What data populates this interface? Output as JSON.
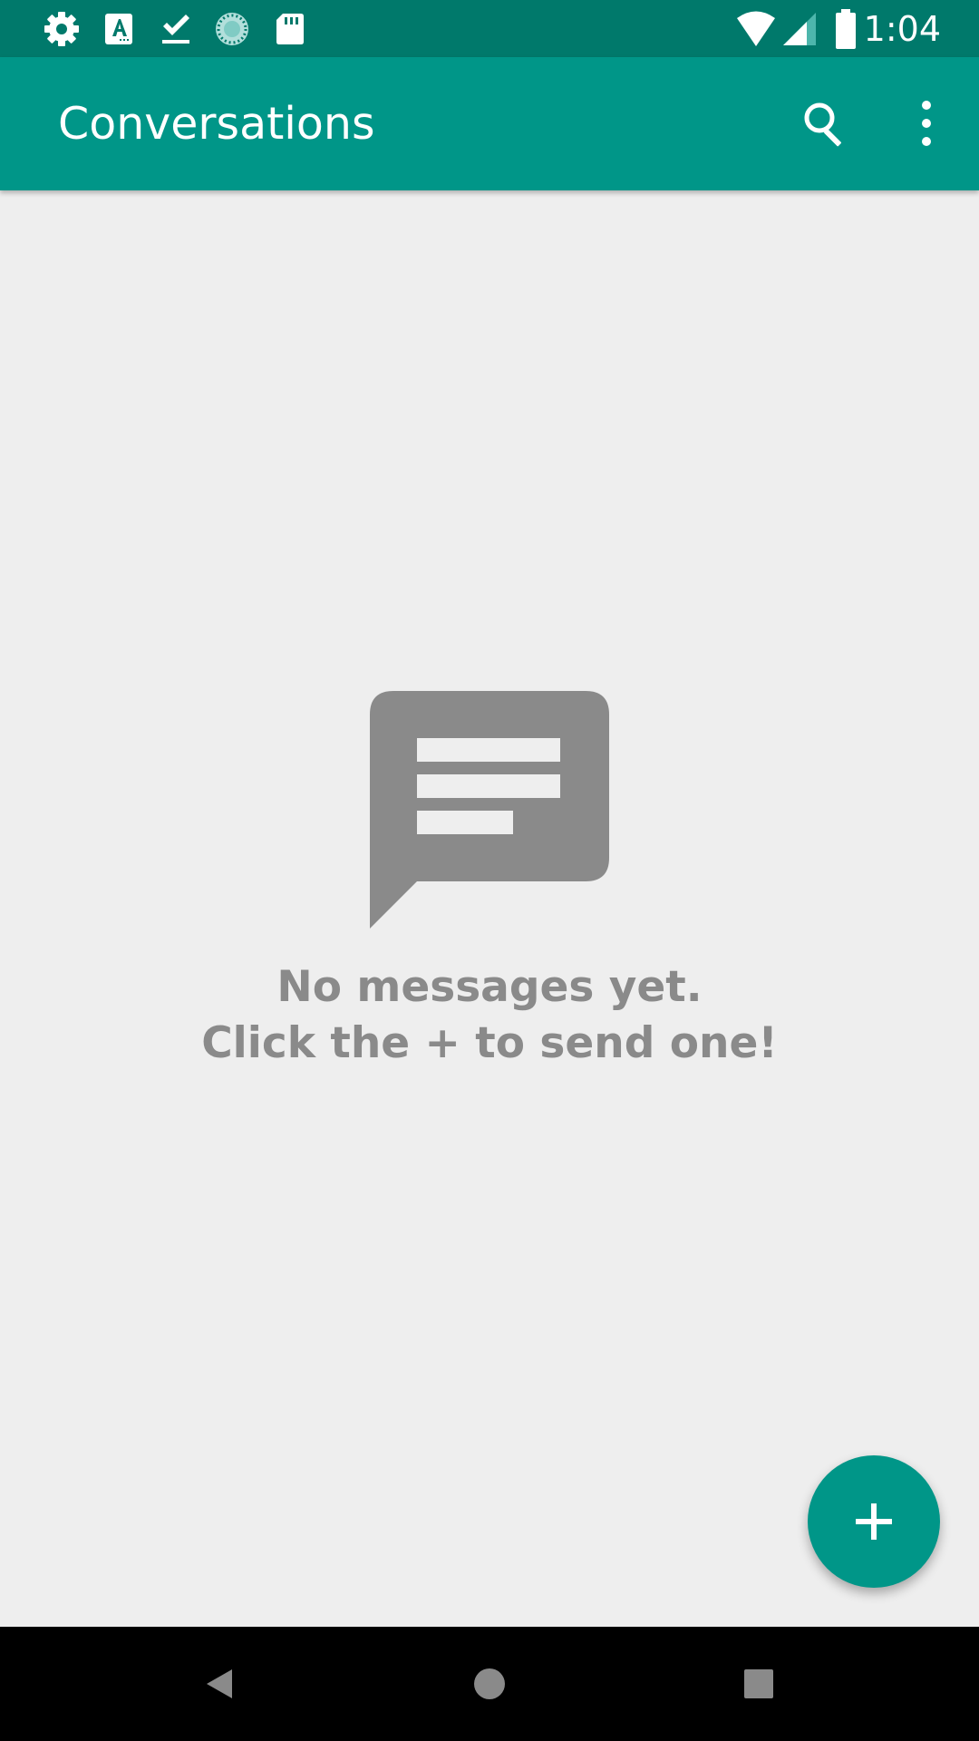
{
  "status_bar": {
    "time": "1:04",
    "left_icons": [
      "gear-icon",
      "font-a-icon",
      "download-done-icon",
      "progress-circle-icon",
      "sd-card-icon"
    ],
    "right_icons": [
      "wifi-icon",
      "cell-signal-icon",
      "battery-icon"
    ]
  },
  "app_bar": {
    "title": "Conversations",
    "actions": [
      "search-icon",
      "overflow-menu-icon"
    ]
  },
  "empty_state": {
    "icon": "message-bubble-icon",
    "line1": "No messages yet.",
    "line2": "Click the + to send one!"
  },
  "fab": {
    "icon": "plus-icon"
  },
  "nav_bar": {
    "buttons": [
      "back-icon",
      "home-icon",
      "recents-icon"
    ]
  },
  "colors": {
    "status_bar": "#00796b",
    "app_bar": "#009688",
    "background": "#eeeeee",
    "empty_state": "#8a8a8a",
    "nav_bar": "#000000"
  }
}
